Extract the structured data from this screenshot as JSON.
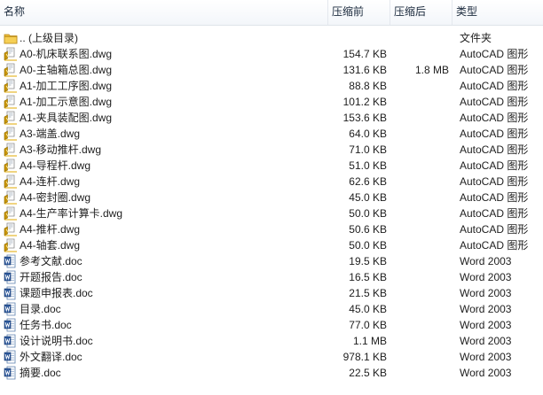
{
  "columns": {
    "name": "名称",
    "compressed": "压缩前",
    "original": "压缩后",
    "type": "类型"
  },
  "files": [
    {
      "name": ".. (上级目录)",
      "compressed": "",
      "original": "",
      "type": "文件夹",
      "icon": "folder-icon"
    },
    {
      "name": "A0-机床联系图.dwg",
      "compressed": "154.7 KB",
      "original": "",
      "type": "AutoCAD 图形",
      "icon": "autocad-file-icon"
    },
    {
      "name": "A0-主轴箱总图.dwg",
      "compressed": "131.6 KB",
      "original": "1.8 MB",
      "type": "AutoCAD 图形",
      "icon": "autocad-file-icon"
    },
    {
      "name": "A1-加工工序图.dwg",
      "compressed": "88.8 KB",
      "original": "",
      "type": "AutoCAD 图形",
      "icon": "autocad-file-icon"
    },
    {
      "name": "A1-加工示意图.dwg",
      "compressed": "101.2 KB",
      "original": "",
      "type": "AutoCAD 图形",
      "icon": "autocad-file-icon"
    },
    {
      "name": "A1-夹具装配图.dwg",
      "compressed": "153.6 KB",
      "original": "",
      "type": "AutoCAD 图形",
      "icon": "autocad-file-icon"
    },
    {
      "name": "A3-端盖.dwg",
      "compressed": "64.0 KB",
      "original": "",
      "type": "AutoCAD 图形",
      "icon": "autocad-file-icon"
    },
    {
      "name": "A3-移动推杆.dwg",
      "compressed": "71.0 KB",
      "original": "",
      "type": "AutoCAD 图形",
      "icon": "autocad-file-icon"
    },
    {
      "name": "A4-导程杆.dwg",
      "compressed": "51.0 KB",
      "original": "",
      "type": "AutoCAD 图形",
      "icon": "autocad-file-icon"
    },
    {
      "name": "A4-连杆.dwg",
      "compressed": "62.6 KB",
      "original": "",
      "type": "AutoCAD 图形",
      "icon": "autocad-file-icon"
    },
    {
      "name": "A4-密封圈.dwg",
      "compressed": "45.0 KB",
      "original": "",
      "type": "AutoCAD 图形",
      "icon": "autocad-file-icon"
    },
    {
      "name": "A4-生产率计算卡.dwg",
      "compressed": "50.0 KB",
      "original": "",
      "type": "AutoCAD 图形",
      "icon": "autocad-file-icon"
    },
    {
      "name": "A4-推杆.dwg",
      "compressed": "50.6 KB",
      "original": "",
      "type": "AutoCAD 图形",
      "icon": "autocad-file-icon"
    },
    {
      "name": "A4-轴套.dwg",
      "compressed": "50.0 KB",
      "original": "",
      "type": "AutoCAD 图形",
      "icon": "autocad-file-icon"
    },
    {
      "name": "参考文献.doc",
      "compressed": "19.5 KB",
      "original": "",
      "type": "Word 2003",
      "icon": "word-doc-icon"
    },
    {
      "name": "开题报告.doc",
      "compressed": "16.5 KB",
      "original": "",
      "type": "Word 2003",
      "icon": "word-doc-icon"
    },
    {
      "name": "课题申报表.doc",
      "compressed": "21.5 KB",
      "original": "",
      "type": "Word 2003",
      "icon": "word-doc-icon"
    },
    {
      "name": "目录.doc",
      "compressed": "45.0 KB",
      "original": "",
      "type": "Word 2003",
      "icon": "word-doc-icon"
    },
    {
      "name": "任务书.doc",
      "compressed": "77.0 KB",
      "original": "",
      "type": "Word 2003",
      "icon": "word-doc-icon"
    },
    {
      "name": "设计说明书.doc",
      "compressed": "1.1 MB",
      "original": "",
      "type": "Word 2003",
      "icon": "word-doc-icon"
    },
    {
      "name": "外文翻译.doc",
      "compressed": "978.1 KB",
      "original": "",
      "type": "Word 2003",
      "icon": "word-doc-icon"
    },
    {
      "name": "摘要.doc",
      "compressed": "22.5 KB",
      "original": "",
      "type": "Word 2003",
      "icon": "word-doc-icon"
    }
  ]
}
